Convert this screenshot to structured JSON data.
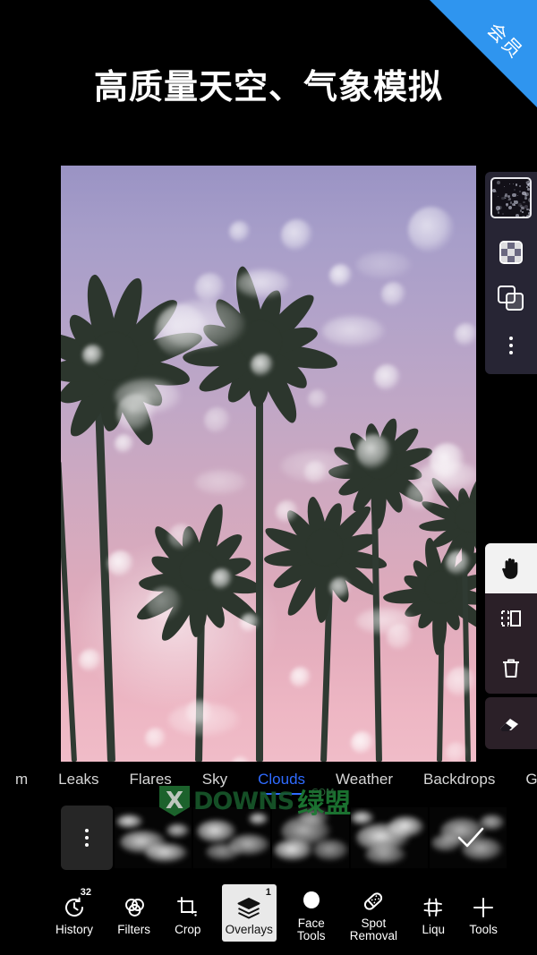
{
  "ribbon": {
    "label": "会员",
    "color": "#2f95ef"
  },
  "headline": {
    "text": "高质量天空、气象模拟"
  },
  "editor": {
    "layer_panel": {
      "thumbnail_name": "layer-thumbnail",
      "buttons": [
        {
          "name": "blend-mode-button",
          "icon": "checkerboard-icon"
        },
        {
          "name": "duplicate-layer-button",
          "icon": "duplicate-icon"
        },
        {
          "name": "layer-more-button",
          "icon": "kebab-menu-icon"
        }
      ]
    },
    "tool_panel": {
      "buttons": [
        {
          "name": "pan-tool-button",
          "icon": "hand-icon",
          "selected": true
        },
        {
          "name": "flip-tool-button",
          "icon": "flip-horizontal-icon",
          "selected": false
        },
        {
          "name": "delete-tool-button",
          "icon": "trash-icon",
          "selected": false
        }
      ],
      "eraser": {
        "name": "eraser-tool-button",
        "icon": "eraser-icon"
      }
    }
  },
  "category_tabs": {
    "items": [
      {
        "label": "m",
        "active": false
      },
      {
        "label": "Leaks",
        "active": false
      },
      {
        "label": "Flares",
        "active": false
      },
      {
        "label": "Sky",
        "active": false
      },
      {
        "label": "Clouds",
        "active": true
      },
      {
        "label": "Weather",
        "active": false
      },
      {
        "label": "Backdrops",
        "active": false
      },
      {
        "label": "G",
        "active": false
      }
    ],
    "active_color": "#2f6bff"
  },
  "thumbnail_strip": {
    "more_button_label": "",
    "thumbnails": [
      {
        "name": "cloud-thumbnail-1"
      },
      {
        "name": "cloud-thumbnail-2"
      },
      {
        "name": "cloud-thumbnail-3"
      },
      {
        "name": "cloud-thumbnail-4"
      },
      {
        "name": "cloud-thumbnail-5"
      }
    ],
    "confirm_label": ""
  },
  "watermark": {
    "mark": "X",
    "text": "DOWNS",
    "suffix": "绿盟",
    "domain": ".COM"
  },
  "bottom_toolbar": {
    "items": [
      {
        "label": "History",
        "badge": "32",
        "icon": "history-icon",
        "selected": false
      },
      {
        "label": "Filters",
        "badge": "",
        "icon": "filters-icon",
        "selected": false
      },
      {
        "label": "Crop",
        "badge": "",
        "icon": "crop-icon",
        "selected": false
      },
      {
        "label": "Overlays",
        "badge": "1",
        "icon": "layers-icon",
        "selected": true
      },
      {
        "label": "Face\nTools",
        "badge": "",
        "icon": "face-icon",
        "selected": false
      },
      {
        "label": "Spot\nRemoval",
        "badge": "",
        "icon": "bandage-icon",
        "selected": false
      },
      {
        "label": "Liqu",
        "badge": "",
        "icon": "liquify-icon",
        "selected": false
      },
      {
        "label": "Tools",
        "badge": "",
        "icon": "plus-icon",
        "selected": false
      }
    ]
  }
}
